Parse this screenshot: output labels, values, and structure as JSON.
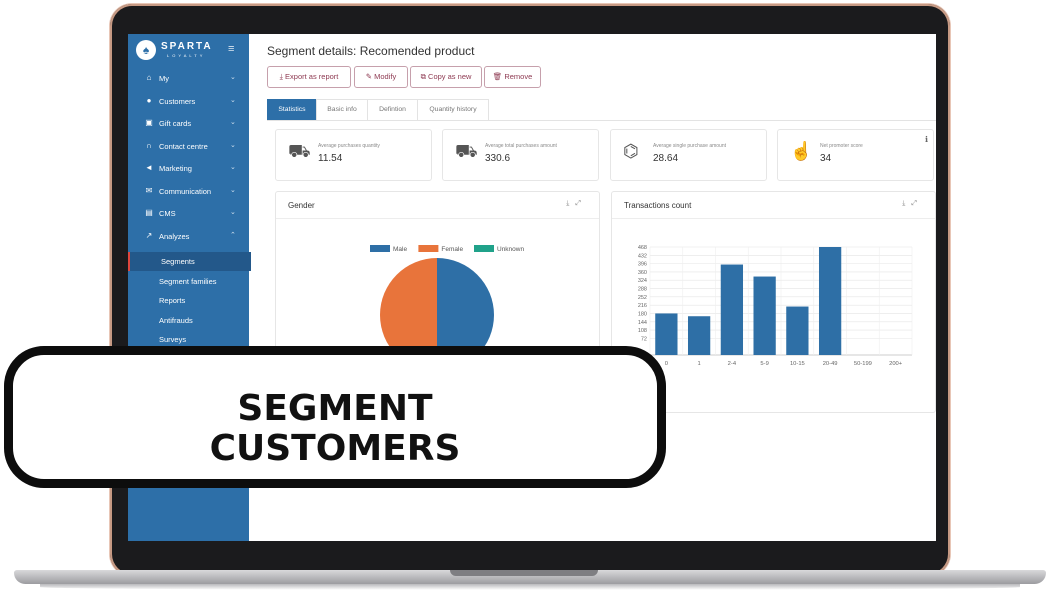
{
  "brand": {
    "name": "SPARTA",
    "sub": "LOYALTY"
  },
  "sidebar": {
    "items": [
      {
        "label": "My",
        "icon": "home-icon",
        "glyph": "⌂"
      },
      {
        "label": "Customers",
        "icon": "user-icon",
        "glyph": "●"
      },
      {
        "label": "Gift cards",
        "icon": "gift-icon",
        "glyph": "▣"
      },
      {
        "label": "Contact centre",
        "icon": "headset-icon",
        "glyph": "∩"
      },
      {
        "label": "Marketing",
        "icon": "megaphone-icon",
        "glyph": "◄"
      },
      {
        "label": "Communication",
        "icon": "envelope-icon",
        "glyph": "✉"
      },
      {
        "label": "CMS",
        "icon": "cms-icon",
        "glyph": "▤"
      },
      {
        "label": "Analyzes",
        "icon": "trend-icon",
        "glyph": "↗"
      }
    ],
    "subitems": [
      {
        "label": "Segments",
        "active": true
      },
      {
        "label": "Segment families"
      },
      {
        "label": "Reports"
      },
      {
        "label": "Antifrauds"
      },
      {
        "label": "Surveys"
      }
    ]
  },
  "page": {
    "title": "Segment details: Recomended product"
  },
  "toolbar": {
    "export": "Export as report",
    "modify": "Modify",
    "copy": "Copy as new",
    "remove": "Remove"
  },
  "tabs": [
    "Statistics",
    "Basic info",
    "Defintion",
    "Quantity history"
  ],
  "stats": [
    {
      "label": "Average purchases quantity",
      "value": "11.54",
      "icon": "cart-icon",
      "glyph": "🛒"
    },
    {
      "label": "Average total purchases amount",
      "value": "330.6",
      "icon": "cart-icon",
      "glyph": "🛒"
    },
    {
      "label": "Average single purchase amount",
      "value": "28.64",
      "icon": "tag-icon",
      "glyph": "🏷"
    },
    {
      "label": "Net promoter score",
      "value": "34",
      "icon": "thumbs-up-icon",
      "glyph": "👍"
    }
  ],
  "panels": {
    "gender": "Gender",
    "transactions": "Transactions count"
  },
  "colors": {
    "male": "#2e6fa6",
    "female": "#e8743b",
    "unknown": "#20a28a",
    "bar": "#2e6fa6"
  },
  "chart_data": [
    {
      "type": "pie",
      "title": "Gender",
      "labels": [
        "Male",
        "Female",
        "Unknown"
      ],
      "values": [
        50,
        50,
        0
      ]
    },
    {
      "type": "bar",
      "title": "Transactions count",
      "categories": [
        "0",
        "1",
        "2-4",
        "5-9",
        "10-15",
        "20-49",
        "50-199",
        "200+"
      ],
      "values": [
        180,
        168,
        392,
        340,
        210,
        468,
        0,
        0
      ],
      "yticks": [
        "468",
        "432",
        "396",
        "360",
        "324",
        "288",
        "252",
        "216",
        "180",
        "144",
        "108",
        "72"
      ],
      "ylim": [
        0,
        468
      ]
    }
  ],
  "banner": {
    "line1": "SEGMENT",
    "line2": "CUSTOMERS"
  }
}
